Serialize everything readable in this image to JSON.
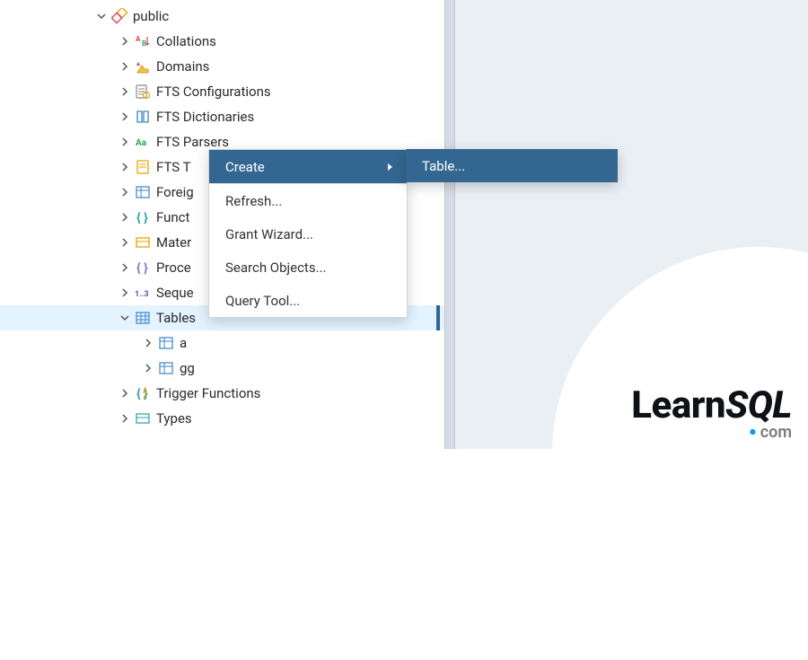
{
  "tree": {
    "schema": {
      "label": "public"
    },
    "items": {
      "collations": {
        "label": "Collations"
      },
      "domains": {
        "label": "Domains"
      },
      "fts_config": {
        "label": "FTS Configurations"
      },
      "fts_dict": {
        "label": "FTS Dictionaries"
      },
      "fts_parsers": {
        "label": "FTS Parsers"
      },
      "fts_templates": {
        "label": "FTS T"
      },
      "foreign": {
        "label": "Foreig"
      },
      "functions": {
        "label": "Funct"
      },
      "materialized": {
        "label": "Mater"
      },
      "procedures": {
        "label": "Proce"
      },
      "sequences": {
        "label": "Seque"
      },
      "tables": {
        "label": "Tables"
      },
      "tables_children": {
        "a": {
          "label": "a"
        },
        "gg": {
          "label": "gg"
        }
      },
      "trigger_functions": {
        "label": "Trigger Functions"
      },
      "types": {
        "label": "Types"
      }
    }
  },
  "context_menu": {
    "create": {
      "label": "Create"
    },
    "refresh": {
      "label": "Refresh..."
    },
    "grant_wizard": {
      "label": "Grant Wizard..."
    },
    "search_objects": {
      "label": "Search Objects..."
    },
    "query_tool": {
      "label": "Query Tool..."
    }
  },
  "submenu": {
    "table": {
      "label": "Table..."
    }
  },
  "brand": {
    "prefix": "Learn",
    "suffix": "SQL",
    "com": "com"
  }
}
